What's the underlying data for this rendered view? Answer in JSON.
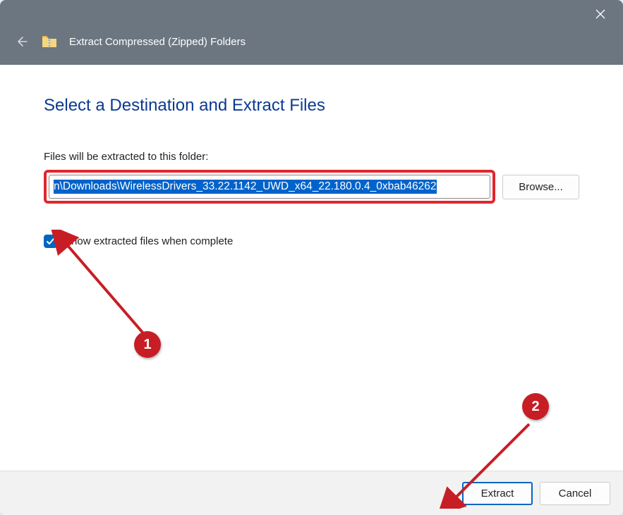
{
  "titlebar": {
    "wizard_title": "Extract Compressed (Zipped) Folders"
  },
  "content": {
    "heading": "Select a Destination and Extract Files",
    "folder_label": "Files will be extracted to this folder:",
    "folder_path": "n\\Downloads\\WirelessDrivers_33.22.1142_UWD_x64_22.180.0.4_0xbab46262",
    "browse_label": "Browse...",
    "checkbox_label": "Show extracted files when complete",
    "checkbox_checked": true
  },
  "footer": {
    "extract_label": "Extract",
    "cancel_label": "Cancel"
  },
  "annotations": {
    "marker1": "1",
    "marker2": "2"
  }
}
